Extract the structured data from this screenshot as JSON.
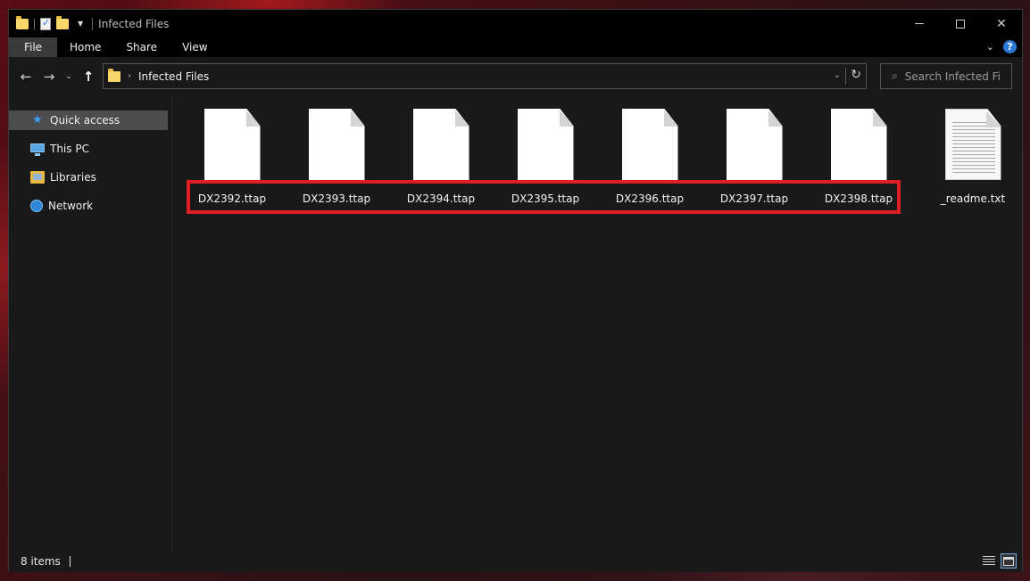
{
  "window": {
    "title": "Infected Files",
    "controls": {
      "minimize_icon": "minimize-icon",
      "maximize_icon": "maximize-icon",
      "close_glyph": "✕"
    }
  },
  "ribbon": {
    "tabs": [
      "File",
      "Home",
      "Share",
      "View"
    ]
  },
  "address_bar": {
    "path": "Infected Files",
    "search_placeholder": "Search Infected Fil..."
  },
  "sidebar": {
    "items": [
      {
        "label": "Quick access",
        "icon": "star-icon",
        "active": true
      },
      {
        "label": "This PC",
        "icon": "monitor-icon",
        "active": false
      },
      {
        "label": "Libraries",
        "icon": "library-icon",
        "active": false
      },
      {
        "label": "Network",
        "icon": "network-icon",
        "active": false
      }
    ]
  },
  "files": [
    {
      "name": "DX2392.ttap",
      "type": "blank"
    },
    {
      "name": "DX2393.ttap",
      "type": "blank"
    },
    {
      "name": "DX2394.ttap",
      "type": "blank"
    },
    {
      "name": "DX2395.ttap",
      "type": "blank"
    },
    {
      "name": "DX2396.ttap",
      "type": "blank"
    },
    {
      "name": "DX2397.ttap",
      "type": "blank"
    },
    {
      "name": "DX2398.ttap",
      "type": "blank"
    },
    {
      "name": "_readme.txt",
      "type": "text"
    }
  ],
  "status": {
    "item_count": "8 items"
  },
  "colors": {
    "highlight_border": "#e01e25",
    "accent_blue": "#2b7ad8",
    "folder_yellow": "#f8d66a"
  }
}
